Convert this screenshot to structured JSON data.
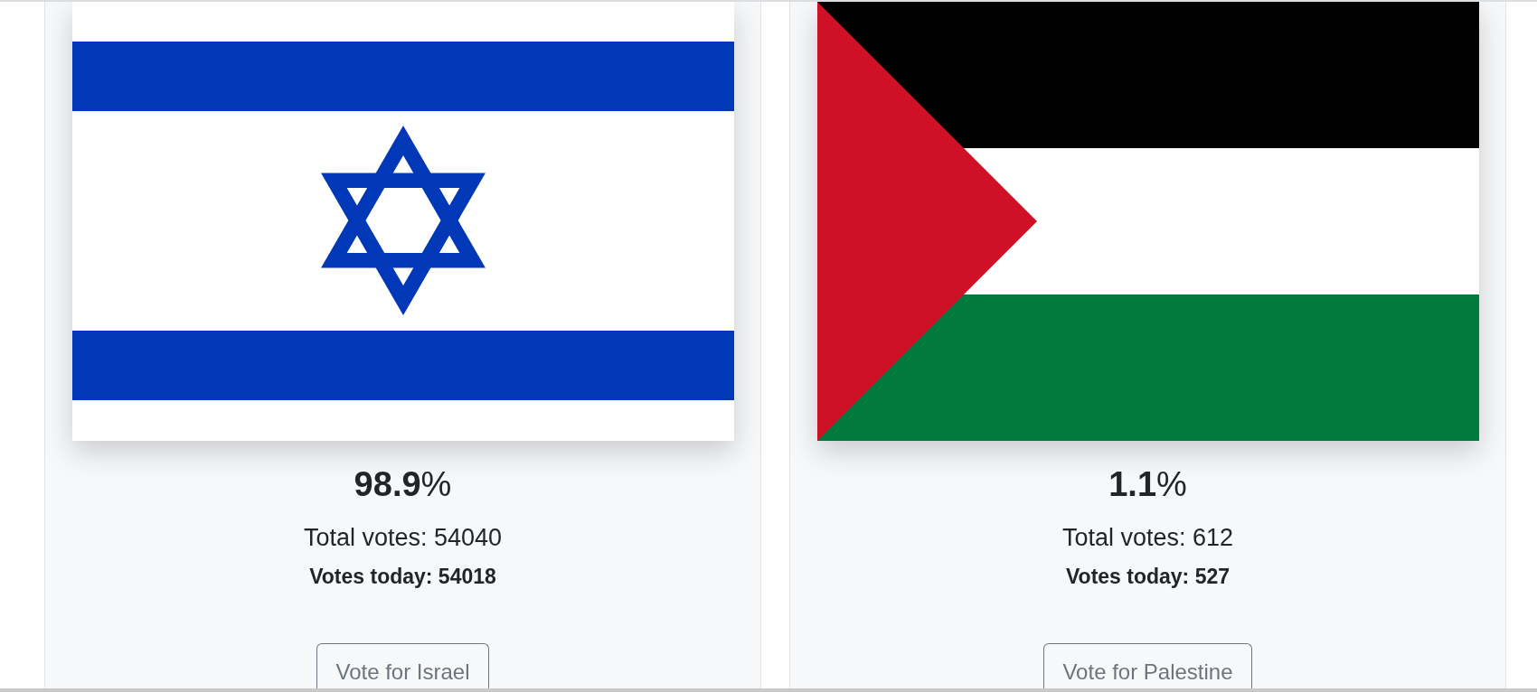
{
  "candidates": [
    {
      "kind": "israel",
      "percent": "**98.9**%",
      "total_votes": "Total votes: 54040",
      "votes_today": "Votes today: 54018",
      "button": "Vote for Israel"
    },
    {
      "kind": "palestine",
      "percent": "**1.1**%",
      "total_votes": "Total votes: 612",
      "votes_today": "Votes today: 527",
      "button": "Vote for Palestine"
    }
  ]
}
